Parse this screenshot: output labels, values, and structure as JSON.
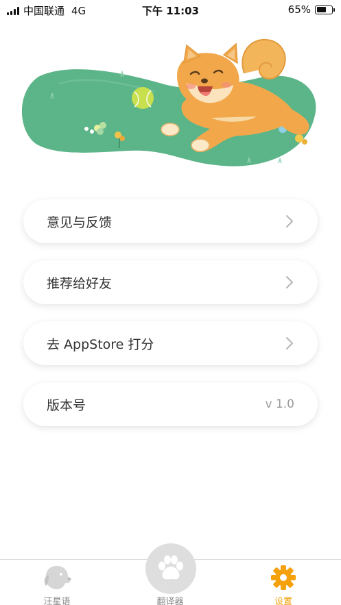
{
  "status_bar": {
    "carrier": "中国联通",
    "network": "4G",
    "time": "下午 11:03",
    "battery_percent": "65%",
    "battery_level": 0.65
  },
  "hero": {
    "illustration": "shiba-dog-on-grass",
    "grass_color": "#5fb48a",
    "dog_color": "#f2a84a"
  },
  "menu": {
    "items": [
      {
        "label": "意见与反馈",
        "icon": "chevron-right-icon"
      },
      {
        "label": "推荐给好友",
        "icon": "chevron-right-icon"
      },
      {
        "label": "去 AppStore 打分",
        "icon": "chevron-right-icon"
      },
      {
        "label": "版本号",
        "value": "v 1.0"
      }
    ]
  },
  "tab_bar": {
    "tabs": [
      {
        "label": "汪星语",
        "icon": "dog-head-icon",
        "active": false
      },
      {
        "label": "翻译器",
        "icon": "paw-icon",
        "active": false
      },
      {
        "label": "设置",
        "icon": "gear-icon",
        "active": true
      }
    ],
    "active_color": "#f4a10c",
    "inactive_color": "#888888"
  }
}
